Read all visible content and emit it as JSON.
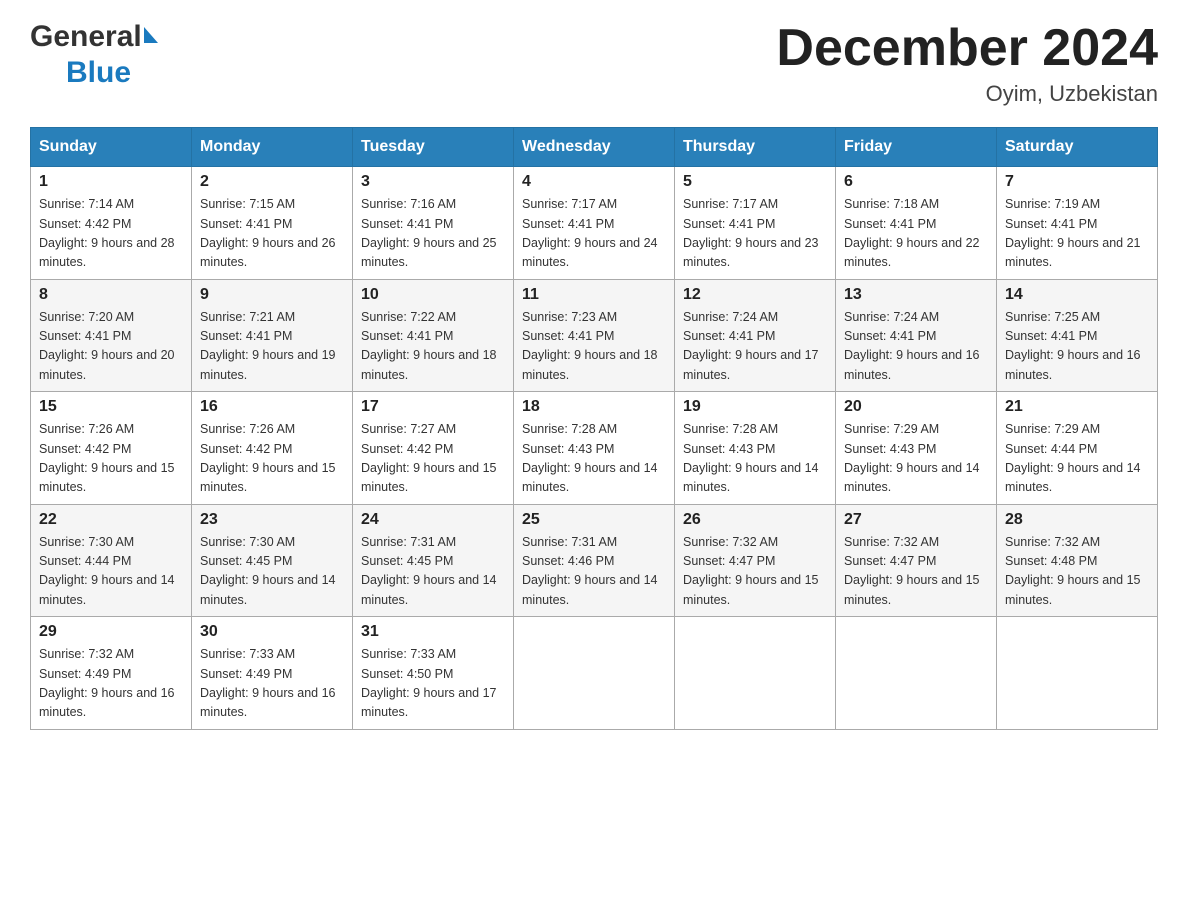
{
  "header": {
    "month_year": "December 2024",
    "location": "Oyim, Uzbekistan",
    "logo_general": "General",
    "logo_blue": "Blue"
  },
  "weekdays": [
    "Sunday",
    "Monday",
    "Tuesday",
    "Wednesday",
    "Thursday",
    "Friday",
    "Saturday"
  ],
  "weeks": [
    [
      {
        "day": "1",
        "sunrise": "7:14 AM",
        "sunset": "4:42 PM",
        "daylight": "9 hours and 28 minutes."
      },
      {
        "day": "2",
        "sunrise": "7:15 AM",
        "sunset": "4:41 PM",
        "daylight": "9 hours and 26 minutes."
      },
      {
        "day": "3",
        "sunrise": "7:16 AM",
        "sunset": "4:41 PM",
        "daylight": "9 hours and 25 minutes."
      },
      {
        "day": "4",
        "sunrise": "7:17 AM",
        "sunset": "4:41 PM",
        "daylight": "9 hours and 24 minutes."
      },
      {
        "day": "5",
        "sunrise": "7:17 AM",
        "sunset": "4:41 PM",
        "daylight": "9 hours and 23 minutes."
      },
      {
        "day": "6",
        "sunrise": "7:18 AM",
        "sunset": "4:41 PM",
        "daylight": "9 hours and 22 minutes."
      },
      {
        "day": "7",
        "sunrise": "7:19 AM",
        "sunset": "4:41 PM",
        "daylight": "9 hours and 21 minutes."
      }
    ],
    [
      {
        "day": "8",
        "sunrise": "7:20 AM",
        "sunset": "4:41 PM",
        "daylight": "9 hours and 20 minutes."
      },
      {
        "day": "9",
        "sunrise": "7:21 AM",
        "sunset": "4:41 PM",
        "daylight": "9 hours and 19 minutes."
      },
      {
        "day": "10",
        "sunrise": "7:22 AM",
        "sunset": "4:41 PM",
        "daylight": "9 hours and 18 minutes."
      },
      {
        "day": "11",
        "sunrise": "7:23 AM",
        "sunset": "4:41 PM",
        "daylight": "9 hours and 18 minutes."
      },
      {
        "day": "12",
        "sunrise": "7:24 AM",
        "sunset": "4:41 PM",
        "daylight": "9 hours and 17 minutes."
      },
      {
        "day": "13",
        "sunrise": "7:24 AM",
        "sunset": "4:41 PM",
        "daylight": "9 hours and 16 minutes."
      },
      {
        "day": "14",
        "sunrise": "7:25 AM",
        "sunset": "4:41 PM",
        "daylight": "9 hours and 16 minutes."
      }
    ],
    [
      {
        "day": "15",
        "sunrise": "7:26 AM",
        "sunset": "4:42 PM",
        "daylight": "9 hours and 15 minutes."
      },
      {
        "day": "16",
        "sunrise": "7:26 AM",
        "sunset": "4:42 PM",
        "daylight": "9 hours and 15 minutes."
      },
      {
        "day": "17",
        "sunrise": "7:27 AM",
        "sunset": "4:42 PM",
        "daylight": "9 hours and 15 minutes."
      },
      {
        "day": "18",
        "sunrise": "7:28 AM",
        "sunset": "4:43 PM",
        "daylight": "9 hours and 14 minutes."
      },
      {
        "day": "19",
        "sunrise": "7:28 AM",
        "sunset": "4:43 PM",
        "daylight": "9 hours and 14 minutes."
      },
      {
        "day": "20",
        "sunrise": "7:29 AM",
        "sunset": "4:43 PM",
        "daylight": "9 hours and 14 minutes."
      },
      {
        "day": "21",
        "sunrise": "7:29 AM",
        "sunset": "4:44 PM",
        "daylight": "9 hours and 14 minutes."
      }
    ],
    [
      {
        "day": "22",
        "sunrise": "7:30 AM",
        "sunset": "4:44 PM",
        "daylight": "9 hours and 14 minutes."
      },
      {
        "day": "23",
        "sunrise": "7:30 AM",
        "sunset": "4:45 PM",
        "daylight": "9 hours and 14 minutes."
      },
      {
        "day": "24",
        "sunrise": "7:31 AM",
        "sunset": "4:45 PM",
        "daylight": "9 hours and 14 minutes."
      },
      {
        "day": "25",
        "sunrise": "7:31 AM",
        "sunset": "4:46 PM",
        "daylight": "9 hours and 14 minutes."
      },
      {
        "day": "26",
        "sunrise": "7:32 AM",
        "sunset": "4:47 PM",
        "daylight": "9 hours and 15 minutes."
      },
      {
        "day": "27",
        "sunrise": "7:32 AM",
        "sunset": "4:47 PM",
        "daylight": "9 hours and 15 minutes."
      },
      {
        "day": "28",
        "sunrise": "7:32 AM",
        "sunset": "4:48 PM",
        "daylight": "9 hours and 15 minutes."
      }
    ],
    [
      {
        "day": "29",
        "sunrise": "7:32 AM",
        "sunset": "4:49 PM",
        "daylight": "9 hours and 16 minutes."
      },
      {
        "day": "30",
        "sunrise": "7:33 AM",
        "sunset": "4:49 PM",
        "daylight": "9 hours and 16 minutes."
      },
      {
        "day": "31",
        "sunrise": "7:33 AM",
        "sunset": "4:50 PM",
        "daylight": "9 hours and 17 minutes."
      },
      null,
      null,
      null,
      null
    ]
  ]
}
